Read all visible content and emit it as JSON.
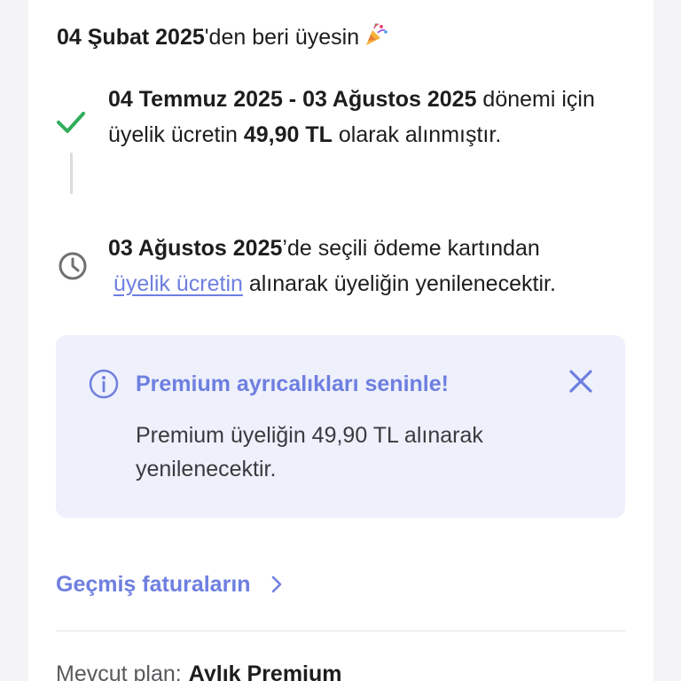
{
  "member_since": {
    "date": "04 Şubat 2025",
    "suffix": "'den beri üyesin",
    "emoji": "🎉"
  },
  "steps": [
    {
      "icon": "check-icon",
      "period": "04 Temmuz 2025 - 03 Ağustos 2025",
      "text1": " dönemi için üyelik ücretin ",
      "amount": "49,90 TL",
      "text2": " olarak alınmıştır."
    },
    {
      "icon": "clock-icon",
      "date": "03 Ağustos 2025",
      "text1": "’de seçili ödeme kartından",
      "link": "üyelik ücretin",
      "text2": " alınarak üyeliğin yenilenecektir."
    }
  ],
  "info_box": {
    "title": "Premium ayrıcalıkları seninle!",
    "body": "Premium üyeliğin 49,90 TL alınarak yenilenecektir.",
    "icon": "info-icon",
    "close_icon": "close-icon"
  },
  "history": {
    "label": "Geçmiş faturaların"
  },
  "plan": {
    "label": "Mevcut plan:",
    "value": "Aylık Premium"
  },
  "colors": {
    "accent": "#6e7fe0",
    "success": "#2fae5b",
    "info_bg": "#eef0fb",
    "page_bg": "#f4f4f6"
  }
}
